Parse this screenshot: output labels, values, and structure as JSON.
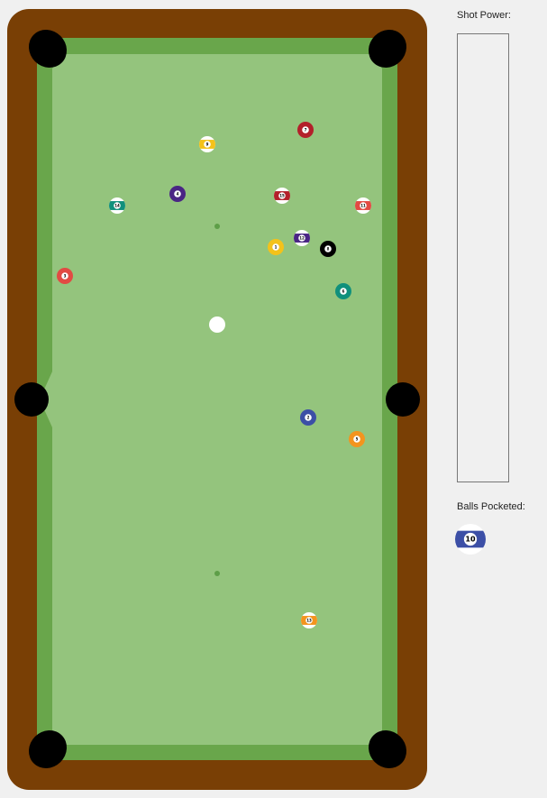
{
  "panel": {
    "shot_power_label": "Shot Power:",
    "shot_power_fraction": 0,
    "balls_pocketed_label": "Balls Pocketed:"
  },
  "colors": {
    "rail": "#793f05",
    "cushion": "#69a64b",
    "felt": "#94c47d",
    "pocket": "#000000",
    "spot": "#5e9e48",
    "ball_1": "#f4c21a",
    "ball_2": "#3c4fa6",
    "ball_3": "#e24a43",
    "ball_4": "#4a2584",
    "ball_5": "#f3941e",
    "ball_6": "#10907c",
    "ball_7": "#b3202a",
    "ball_8": "#000000",
    "cue": "#ffffff"
  },
  "balls_on_table": [
    {
      "number": "1",
      "label": "1",
      "kind": "solid"
    },
    {
      "number": "2",
      "label": "2",
      "kind": "solid"
    },
    {
      "number": "3",
      "label": "3",
      "kind": "solid"
    },
    {
      "number": "4",
      "label": "4",
      "kind": "solid"
    },
    {
      "number": "5",
      "label": "5",
      "kind": "solid"
    },
    {
      "number": "6",
      "label": "6",
      "kind": "solid"
    },
    {
      "number": "7",
      "label": "7",
      "kind": "solid"
    },
    {
      "number": "8",
      "label": "8",
      "kind": "solid"
    },
    {
      "number": "9",
      "label": "9",
      "kind": "stripe"
    },
    {
      "number": "11",
      "label": "11",
      "kind": "stripe"
    },
    {
      "number": "12",
      "label": "12",
      "kind": "stripe"
    },
    {
      "number": "13",
      "label": "13",
      "kind": "stripe"
    },
    {
      "number": "14",
      "label": "14",
      "kind": "stripe"
    },
    {
      "number": "15",
      "label": "15",
      "kind": "stripe"
    },
    {
      "number": "cue",
      "label": "",
      "kind": "cue"
    }
  ],
  "balls_pocketed": [
    {
      "number": "10",
      "label": "10",
      "kind": "stripe"
    }
  ]
}
